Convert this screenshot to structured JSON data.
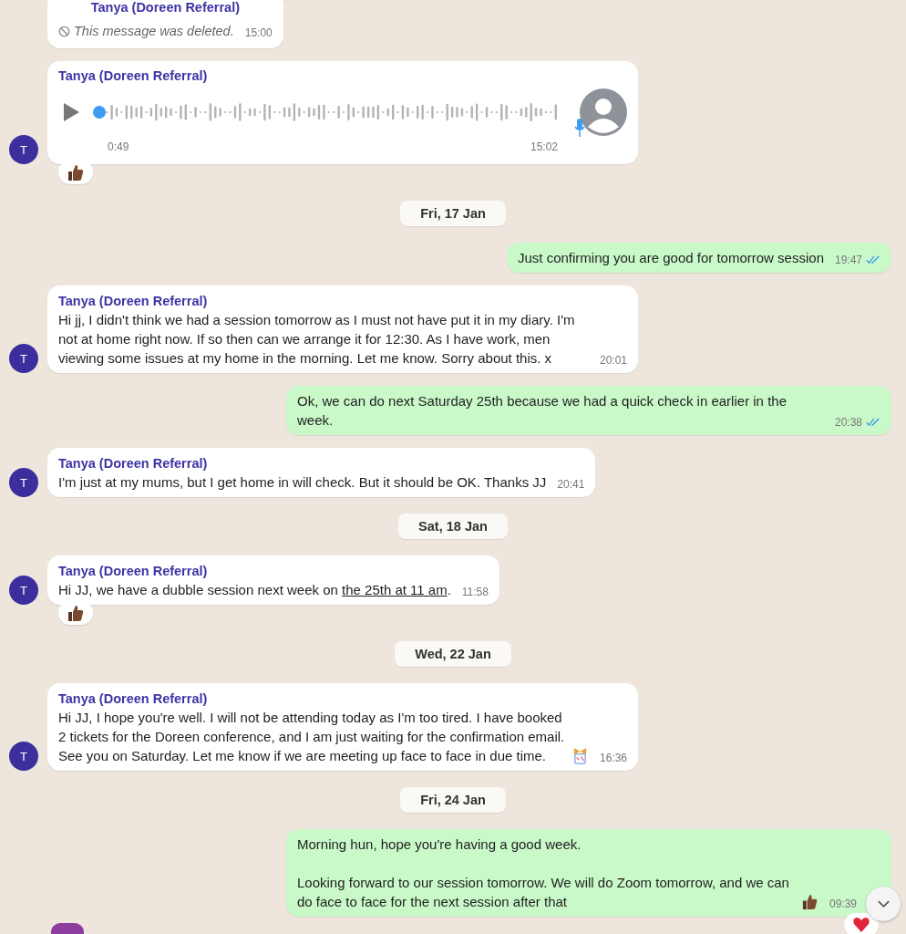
{
  "chat": [
    {
      "kind": "incoming",
      "sender": "Tanya (Doreen Referral)",
      "body": {
        "kind": "deleted",
        "text": "This message was deleted."
      },
      "time": "15:00"
    },
    {
      "kind": "incoming",
      "sender": "Tanya (Doreen Referral)",
      "avatar": "T",
      "body": {
        "kind": "voice",
        "duration": "0:49"
      },
      "time": "15:02",
      "reaction": {
        "kind": "thumbs_up"
      }
    },
    {
      "kind": "date",
      "label": "Fri, 17 Jan"
    },
    {
      "kind": "outgoing",
      "body": {
        "kind": "text",
        "segments": [
          {
            "text": "Just confirming you are good for tomorrow session"
          }
        ]
      },
      "time": "19:47",
      "read": true
    },
    {
      "kind": "incoming",
      "sender": "Tanya (Doreen Referral)",
      "avatar": "T",
      "body": {
        "kind": "text",
        "segments": [
          {
            "text": "Hi jj, I didn't think we had a session tomorrow as I must not have put it in my diary. I'm not at home right now. If so then can we arrange it for 12:30. As I have work, men viewing some issues at my home in the morning. Let me know. Sorry about this. x"
          }
        ]
      },
      "time": "20:01"
    },
    {
      "kind": "outgoing",
      "body": {
        "kind": "text",
        "segments": [
          {
            "text": "Ok, we can do next Saturday 25th because we had a quick check in earlier in the week."
          }
        ]
      },
      "time": "20:38",
      "read": true
    },
    {
      "kind": "incoming",
      "sender": "Tanya (Doreen Referral)",
      "avatar": "T",
      "body": {
        "kind": "text",
        "segments": [
          {
            "text": "I'm just at my mums, but I get home in will check. But it should be OK. Thanks JJ"
          }
        ]
      },
      "time": "20:41"
    },
    {
      "kind": "date",
      "label": "Sat, 18 Jan"
    },
    {
      "kind": "incoming",
      "sender": "Tanya (Doreen Referral)",
      "avatar": "T",
      "body": {
        "kind": "text",
        "segments": [
          {
            "text": "Hi JJ, we have a dubble session next week on "
          },
          {
            "text": "the 25th at 11 am",
            "kind": "link"
          },
          {
            "text": "."
          }
        ]
      },
      "time": "11:58",
      "reaction": {
        "kind": "thumbs_up"
      }
    },
    {
      "kind": "date",
      "label": "Wed, 22 Jan"
    },
    {
      "kind": "incoming",
      "sender": "Tanya (Doreen Referral)",
      "avatar": "T",
      "body": {
        "kind": "text",
        "segments": [
          {
            "text": "Hi JJ, I hope you're well. I will not be attending today as I'm too tired. I have booked 2 tickets for the Doreen conference, and I am just waiting for the confirmation email. See you on Saturday. Let me know if we are meeting up face to face in due time."
          }
        ],
        "emoji": {
          "kind": "ribbon"
        }
      },
      "time": "16:36"
    },
    {
      "kind": "date",
      "label": "Fri, 24 Jan"
    },
    {
      "kind": "outgoing",
      "body": {
        "kind": "text",
        "segments": [
          {
            "text": "Morning hun, hope you're having a good week.\n\nLooking forward to our session tomorrow. We will do Zoom tomorrow, and we can do face to face for the next session after that"
          }
        ],
        "emoji": {
          "kind": "thumbs_up"
        }
      },
      "time": "09:39",
      "reaction": {
        "kind": "heart"
      }
    }
  ]
}
